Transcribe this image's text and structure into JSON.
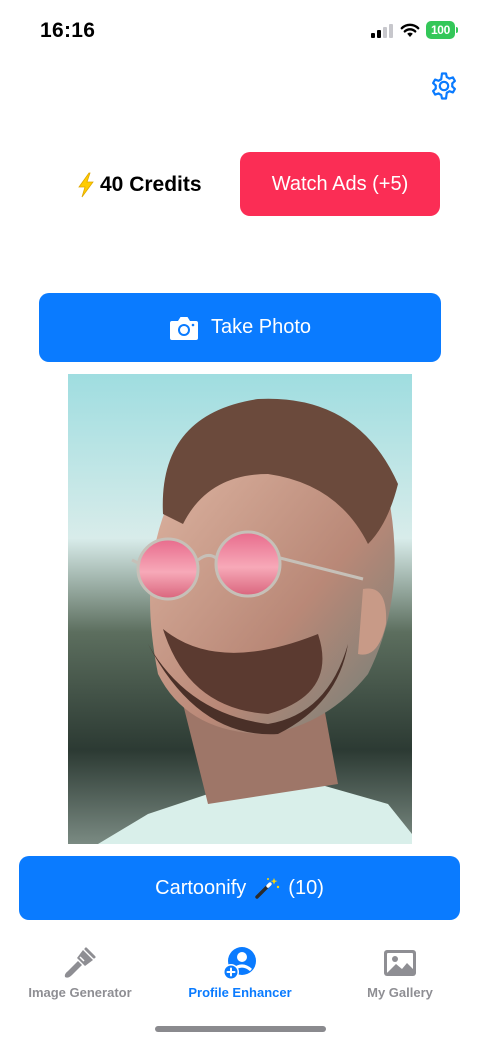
{
  "status_bar": {
    "time": "16:16",
    "battery": "100",
    "icons": [
      "signal-icon",
      "wifi-icon",
      "battery-icon"
    ]
  },
  "header": {
    "settings_icon": "gear-icon"
  },
  "credits": {
    "icon": "lightning-bolt-icon",
    "label": "40 Credits"
  },
  "watch_ads": {
    "label": "Watch Ads (+5)"
  },
  "take_photo": {
    "icon": "camera-icon",
    "label": "Take Photo"
  },
  "photo": {
    "subject": "portrait-photo"
  },
  "cartoonify": {
    "label": "Cartoonify",
    "icon": "magic-wand-icon",
    "cost": "(10)"
  },
  "tab_bar": {
    "tabs": [
      {
        "label": "Image Generator",
        "icon": "paintbrush-icon",
        "active": false
      },
      {
        "label": "Profile Enhancer",
        "icon": "profile-add-icon",
        "active": true
      },
      {
        "label": "My Gallery",
        "icon": "photo-icon",
        "active": false
      }
    ]
  },
  "colors": {
    "primary": "#0a7bff",
    "accent": "#fb2d55",
    "battery": "#34c759",
    "inactive": "#8e8e93"
  }
}
